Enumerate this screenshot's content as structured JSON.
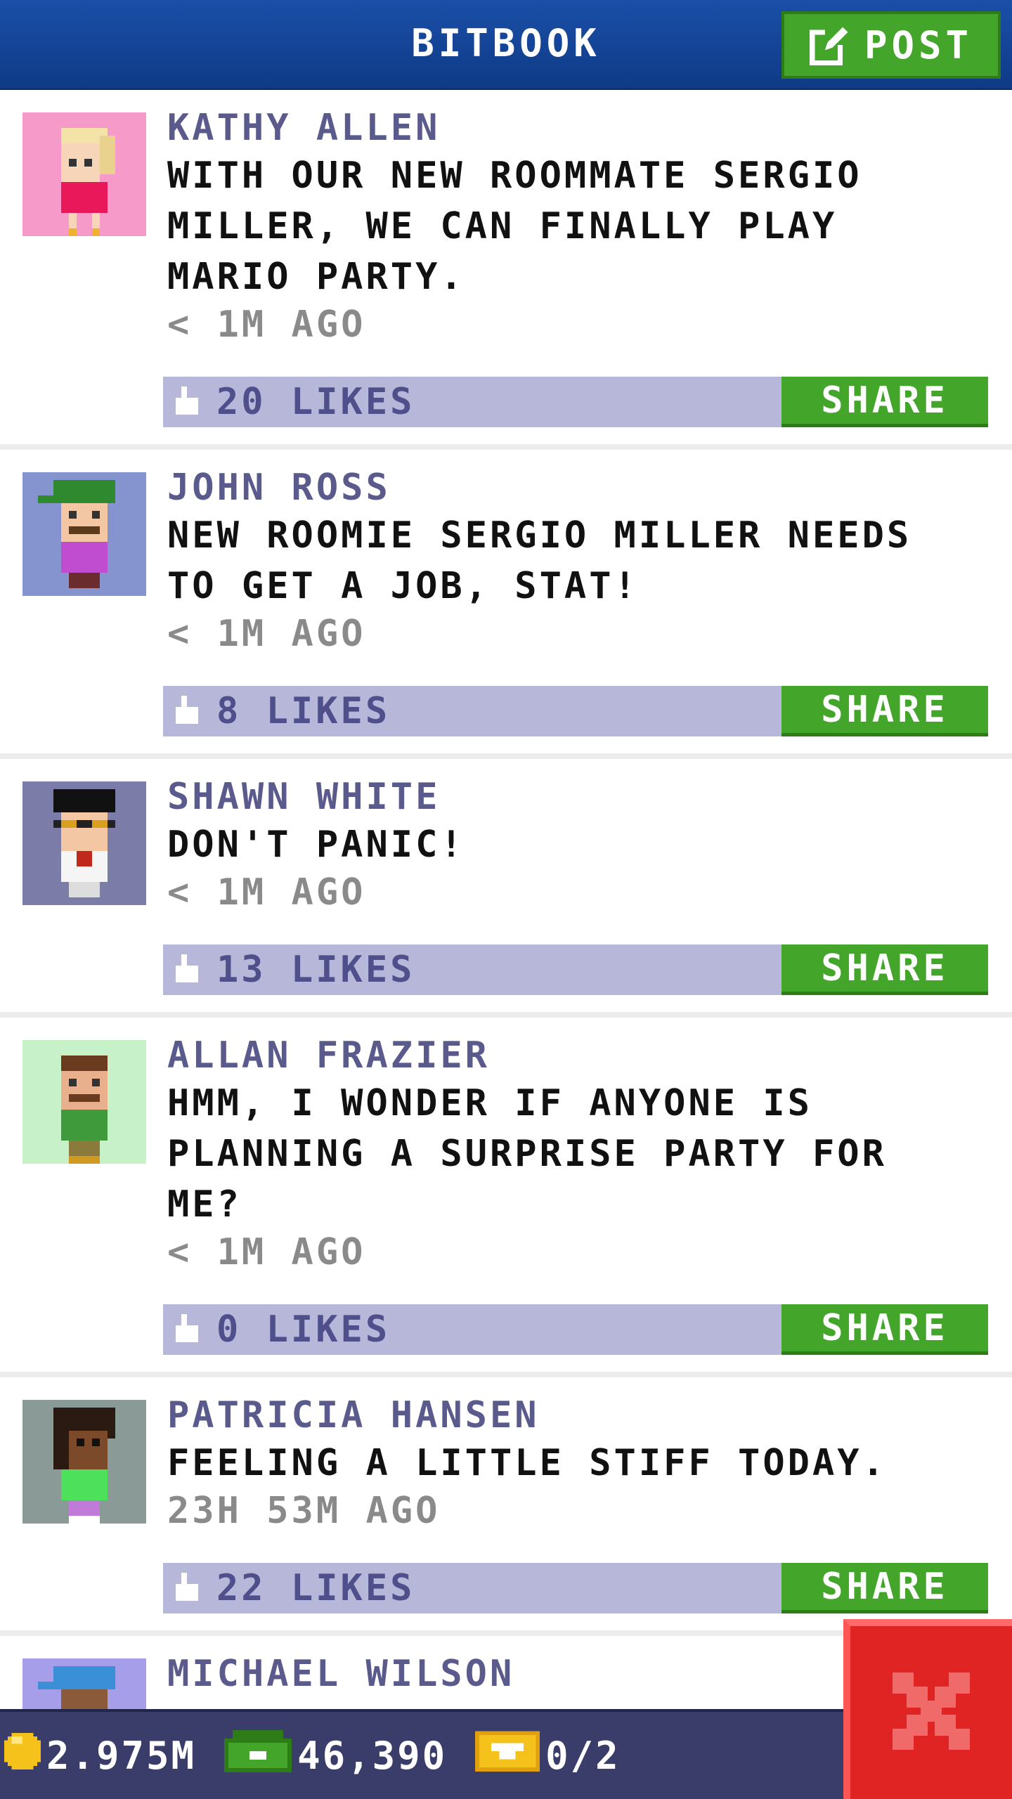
{
  "header": {
    "title": "BITBOOK",
    "post_label": "POST"
  },
  "posts": [
    {
      "name": "KATHY ALLEN",
      "text": "WITH OUR NEW ROOMMATE SERGIO MILLER, WE CAN FINALLY PLAY MARIO PARTY.",
      "time": "< 1M AGO",
      "likes": "20 LIKES",
      "share_label": "SHARE",
      "avatar_bg": "#f59ac9"
    },
    {
      "name": "JOHN ROSS",
      "text": "NEW ROOMIE SERGIO MILLER NEEDS TO GET A JOB, STAT!",
      "time": "< 1M AGO",
      "likes": "8 LIKES",
      "share_label": "SHARE",
      "avatar_bg": "#8593cf"
    },
    {
      "name": "SHAWN WHITE",
      "text": "DON'T PANIC!",
      "time": "< 1M AGO",
      "likes": "13 LIKES",
      "share_label": "SHARE",
      "avatar_bg": "#7b7ca8"
    },
    {
      "name": "ALLAN FRAZIER",
      "text": "HMM, I WONDER IF ANYONE IS PLANNING A SURPRISE PARTY FOR ME?",
      "time": "< 1M AGO",
      "likes": "0 LIKES",
      "share_label": "SHARE",
      "avatar_bg": "#c7f2c9"
    },
    {
      "name": "PATRICIA HANSEN",
      "text": "FEELING A LITTLE STIFF TODAY.",
      "time": "23H 53M AGO",
      "likes": "22 LIKES",
      "share_label": "SHARE",
      "avatar_bg": "#8a9a97"
    },
    {
      "name": "MICHAEL WILSON",
      "avatar_bg": "#a79ee9"
    }
  ],
  "status": {
    "coins": "2.975M",
    "bux": "46,390",
    "tickets": "0/2"
  },
  "colors": {
    "header": "#1a4fa8",
    "share_green": "#43a52a",
    "likes_bar": "#b6b7d9",
    "name_purple": "#5b5a8c",
    "close_red": "#e02424"
  }
}
